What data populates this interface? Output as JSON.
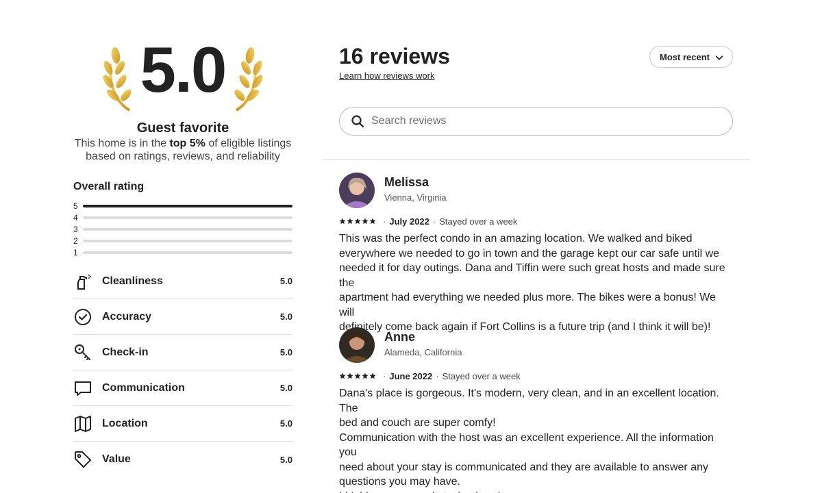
{
  "summary": {
    "overall_score": "5.0",
    "badge_title": "Guest favorite",
    "badge_desc_pre": "This home is in the ",
    "badge_desc_bold": "top 5%",
    "badge_desc_post": " of eligible listings based on ratings, reviews, and reliability"
  },
  "overall_rating": {
    "title": "Overall rating",
    "rows": [
      {
        "label": "5",
        "fraction": 1.0
      },
      {
        "label": "4",
        "fraction": 0
      },
      {
        "label": "3",
        "fraction": 0
      },
      {
        "label": "2",
        "fraction": 0
      },
      {
        "label": "1",
        "fraction": 0
      }
    ]
  },
  "categories": [
    {
      "label": "Cleanliness",
      "value": "5.0",
      "icon": "spray-bottle-icon"
    },
    {
      "label": "Accuracy",
      "value": "5.0",
      "icon": "check-circle-icon"
    },
    {
      "label": "Check-in",
      "value": "5.0",
      "icon": "key-icon"
    },
    {
      "label": "Communication",
      "value": "5.0",
      "icon": "message-icon"
    },
    {
      "label": "Location",
      "value": "5.0",
      "icon": "map-icon"
    },
    {
      "label": "Value",
      "value": "5.0",
      "icon": "tag-icon"
    }
  ],
  "reviews_header": {
    "count": "16 reviews",
    "learn_link": "Learn how reviews work",
    "sort_label": "Most recent",
    "search_placeholder": "Search reviews"
  },
  "reviews": [
    {
      "name": "Melissa",
      "location": "Vienna, Virginia",
      "date": "July 2022",
      "stay": "Stayed over a week",
      "rating": 5,
      "avatar_color": "#a37bc4",
      "text": "This was the perfect condo in an amazing location. We walked and biked\neverywhere we needed to go in town and the garage kept our car safe until we\nneeded it for day outings. Dana and Tiffin were such great hosts and made sure the\napartment had everything we needed plus more. The bikes were a bonus! We will\ndefinitely come back again if Fort Collins is a future trip (and I think it will be)!"
    },
    {
      "name": "Anne",
      "location": "Alameda, California",
      "date": "June 2022",
      "stay": "Stayed over a week",
      "rating": 5,
      "avatar_color": "#6b4a2e",
      "text": "Dana's place is gorgeous. It's modern, very clean, and in an excellent location. The\nbed and couch are super comfy!\nCommunication with the host was an excellent experience. All the information you\nneed about your stay is communicated and they are available to answer any\nquestions you may have.\nI highly recommend staying here!"
    }
  ],
  "colors": {
    "accent": "#222222",
    "laurel_gold": "#e0b53a",
    "divider": "#dddddd"
  }
}
